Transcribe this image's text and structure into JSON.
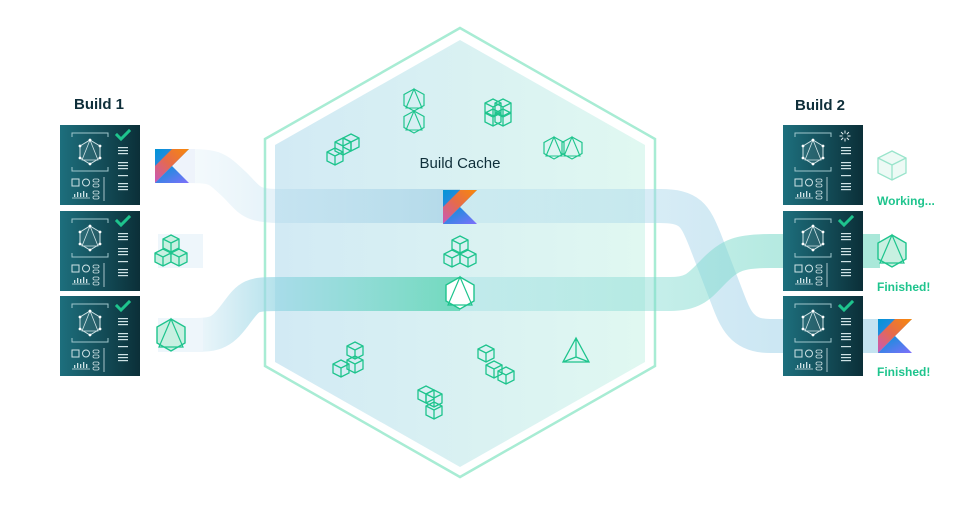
{
  "diagram": {
    "title": "Build Cache",
    "colors": {
      "accent_green": "#1ec48d",
      "card_dark": "#0c3a44",
      "card_light": "#1a6a78",
      "flow_blue": "#a6d5ea",
      "flow_green": "#5fd6b4",
      "hex_border": "#a8ecd4",
      "hex_fill": "#d5eff3",
      "text_dark": "#0f2f3a"
    },
    "build1": {
      "label": "Build 1",
      "tasks": [
        {
          "icon": "kotlin-logo",
          "status": "check"
        },
        {
          "icon": "cube-stack",
          "status": "check"
        },
        {
          "icon": "octahedron",
          "status": "check"
        }
      ]
    },
    "build2": {
      "label": "Build 2",
      "tasks": [
        {
          "icon": "cube",
          "status": "spinner",
          "status_text": "Working..."
        },
        {
          "icon": "octahedron",
          "status": "check",
          "status_text": "Finished!"
        },
        {
          "icon": "kotlin-logo",
          "status": "check",
          "status_text": "Finished!"
        }
      ]
    },
    "cache_items": [
      "cube-stair",
      "double-icosahedron",
      "cube-2x2",
      "double-octahedron",
      "kotlin-logo",
      "cube-stack",
      "octahedron",
      "cube-L",
      "cube-corner",
      "cube-zigzag",
      "tetrahedron"
    ]
  }
}
